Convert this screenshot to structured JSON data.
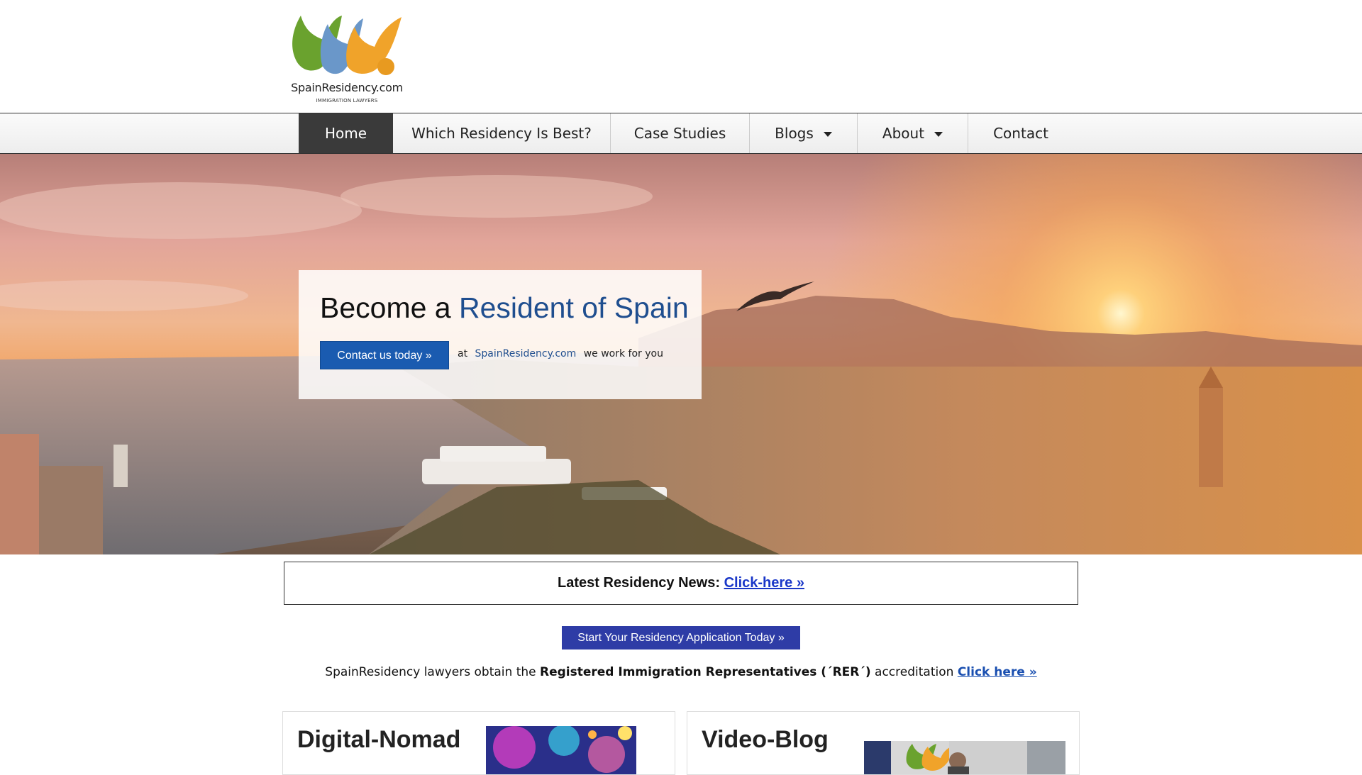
{
  "header": {
    "logo_text": "SpainResidency.com",
    "logo_subtext": "IMMIGRATION LAWYERS"
  },
  "nav": {
    "items": [
      {
        "label": "Home",
        "active": true,
        "dropdown": false
      },
      {
        "label": "Which Residency Is Best?",
        "active": false,
        "dropdown": false
      },
      {
        "label": "Case Studies",
        "active": false,
        "dropdown": false
      },
      {
        "label": "Blogs",
        "active": false,
        "dropdown": true
      },
      {
        "label": "About",
        "active": false,
        "dropdown": true
      },
      {
        "label": "Contact",
        "active": false,
        "dropdown": false
      }
    ]
  },
  "hero": {
    "title_prefix": "Become a",
    "title_accent": "Resident of Spain",
    "cta_label": "Contact us today »",
    "at_text": "at",
    "site_name": "SpainResidency.com",
    "tail_text": "we work for you"
  },
  "news": {
    "label": "Latest Residency News:",
    "link": "Click-here »"
  },
  "apply": {
    "label": "Start Your Residency Application Today »"
  },
  "rer": {
    "prefix": "SpainResidency lawyers obtain the",
    "bold": "Registered Immigration Representatives (´RER´)",
    "suffix": "accreditation",
    "link": "Click here »"
  },
  "cards": [
    {
      "title": "Digital-Nomad"
    },
    {
      "title": "Video-Blog"
    }
  ],
  "colors": {
    "accent_blue": "#1f4e8f",
    "button_blue": "#1a5bb0",
    "apply_blue": "#2e3ca6",
    "link_blue": "#1a37c8",
    "nav_active": "#3a3a3a"
  }
}
